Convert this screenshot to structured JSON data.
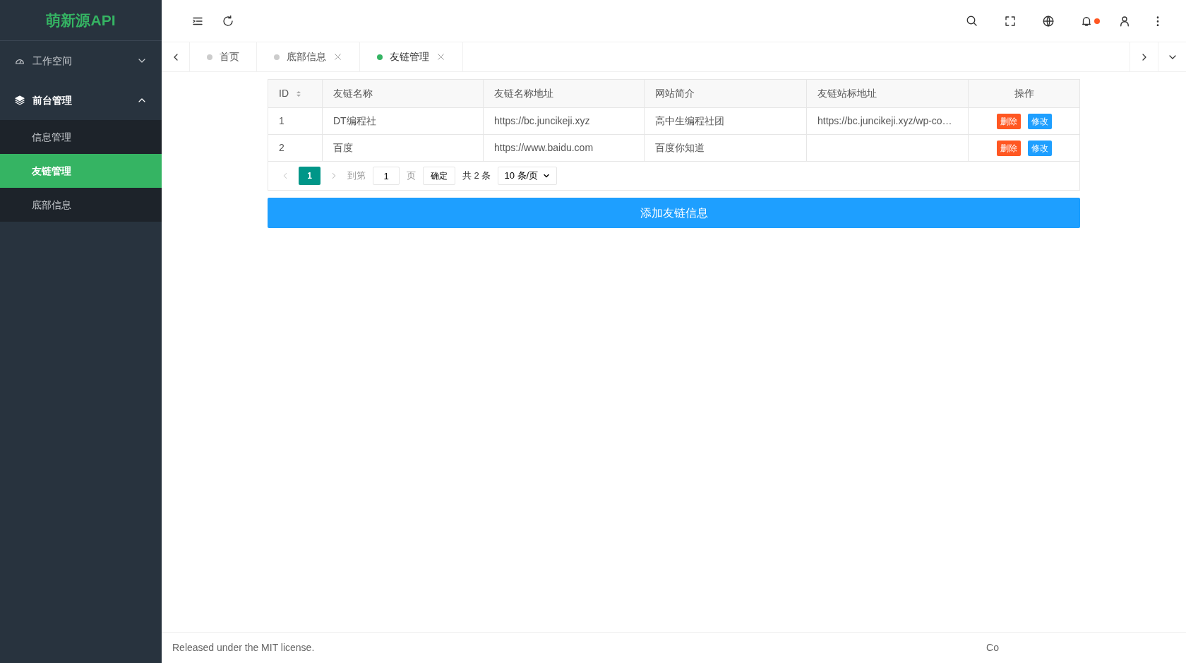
{
  "sidebar": {
    "logo": "萌新源API",
    "menu": [
      {
        "label": "工作空间",
        "expanded": false
      },
      {
        "label": "前台管理",
        "expanded": true,
        "children": [
          {
            "label": "信息管理",
            "selected": false
          },
          {
            "label": "友链管理",
            "selected": true
          },
          {
            "label": "底部信息",
            "selected": false
          }
        ]
      }
    ]
  },
  "tabs": [
    {
      "label": "首页",
      "selected": false,
      "closable": false
    },
    {
      "label": "底部信息",
      "selected": false,
      "closable": true
    },
    {
      "label": "友链管理",
      "selected": true,
      "closable": true
    }
  ],
  "notifications": {
    "unread": true
  },
  "table": {
    "columns": [
      {
        "label": "ID",
        "sortable": true
      },
      {
        "label": "友链名称",
        "sortable": false
      },
      {
        "label": "友链名称地址",
        "sortable": false
      },
      {
        "label": "网站简介",
        "sortable": false
      },
      {
        "label": "友链站标地址",
        "sortable": false
      },
      {
        "label": "操作",
        "sortable": false
      }
    ],
    "rows": [
      {
        "cells": [
          "1",
          "DT编程社",
          "https://bc.juncikeji.xyz",
          "高中生编程社团",
          "https://bc.juncikeji.xyz/wp-co…"
        ],
        "actions": [
          "删除",
          "修改"
        ]
      },
      {
        "cells": [
          "2",
          "百度",
          "https://www.baidu.com",
          "百度你知道",
          ""
        ],
        "actions": [
          "删除",
          "修改"
        ]
      }
    ]
  },
  "pagination": {
    "current_page": "1",
    "goto_label": "到第",
    "goto_value": "1",
    "page_unit": "页",
    "confirm": "确定",
    "total": "共 2 条",
    "page_size": "10 条/页"
  },
  "add_button": "添加友链信息",
  "footer": {
    "left": "Released under the MIT license.",
    "right": "Co"
  }
}
